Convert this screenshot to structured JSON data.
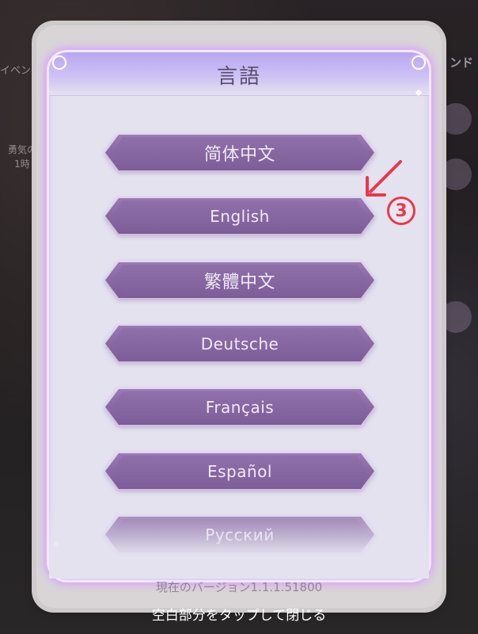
{
  "background": {
    "left_label": "イベン",
    "right_label": "ンド",
    "left_text": "勇気の\n1時"
  },
  "dialog": {
    "title": "言語",
    "languages": [
      {
        "label": "简体中文"
      },
      {
        "label": "English"
      },
      {
        "label": "繁體中文"
      },
      {
        "label": "Deutsche"
      },
      {
        "label": "Français"
      },
      {
        "label": "Español"
      },
      {
        "label": "Русский"
      }
    ],
    "version_text": "現在のバージョン1.1.1.51800",
    "close_hint": "空白部分をタップして閉じる"
  },
  "annotation": {
    "step_number": "3",
    "color": "#e8384b"
  },
  "colors": {
    "panel": "#e4e2ef",
    "header": "#b7a6f0",
    "button": "#8a6aa4",
    "glow": "#d59cff"
  }
}
